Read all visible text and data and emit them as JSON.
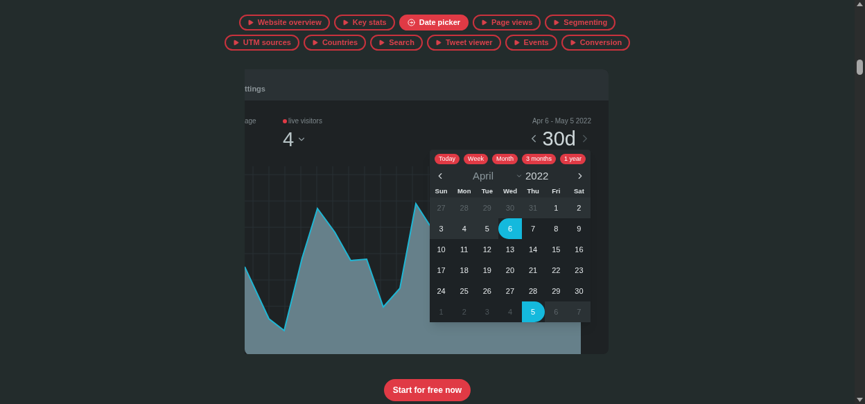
{
  "demo_tabs": [
    [
      {
        "label": "Website overview",
        "selected": false
      },
      {
        "label": "Key stats",
        "selected": false
      },
      {
        "label": "Date picker",
        "selected": true
      },
      {
        "label": "Page views",
        "selected": false
      },
      {
        "label": "Segmenting",
        "selected": false
      }
    ],
    [
      {
        "label": "UTM sources",
        "selected": false
      },
      {
        "label": "Countries",
        "selected": false
      },
      {
        "label": "Search",
        "selected": false
      },
      {
        "label": "Tweet viewer",
        "selected": false
      },
      {
        "label": "Events",
        "selected": false
      },
      {
        "label": "Conversion",
        "selected": false
      }
    ]
  ],
  "panel": {
    "header_tab": "ttings",
    "stat_left_label": "age",
    "live": {
      "label": "live visitors",
      "value": "4"
    },
    "range_label": "Apr 6 - May 5 2022",
    "period": "30d"
  },
  "date_picker": {
    "presets": [
      "Today",
      "Week",
      "Month",
      "3 months",
      "1 year"
    ],
    "month": "April",
    "year": "2022",
    "weekdays": [
      "Sun",
      "Mon",
      "Tue",
      "Wed",
      "Thu",
      "Fri",
      "Sat"
    ],
    "weeks": [
      [
        {
          "day": "27",
          "muted": true,
          "in_range": false,
          "selected": false
        },
        {
          "day": "28",
          "muted": true,
          "in_range": false,
          "selected": false
        },
        {
          "day": "29",
          "muted": true,
          "in_range": false,
          "selected": false
        },
        {
          "day": "30",
          "muted": true,
          "in_range": false,
          "selected": false
        },
        {
          "day": "31",
          "muted": true,
          "in_range": false,
          "selected": false
        },
        {
          "day": "1",
          "muted": false,
          "in_range": false,
          "selected": false
        },
        {
          "day": "2",
          "muted": false,
          "in_range": false,
          "selected": false
        }
      ],
      [
        {
          "day": "3",
          "muted": false,
          "in_range": false,
          "selected": false
        },
        {
          "day": "4",
          "muted": false,
          "in_range": false,
          "selected": false
        },
        {
          "day": "5",
          "muted": false,
          "in_range": false,
          "selected": false
        },
        {
          "day": "6",
          "muted": false,
          "in_range": true,
          "selected": true
        },
        {
          "day": "7",
          "muted": false,
          "in_range": true,
          "selected": false
        },
        {
          "day": "8",
          "muted": false,
          "in_range": true,
          "selected": false
        },
        {
          "day": "9",
          "muted": false,
          "in_range": true,
          "selected": false
        }
      ],
      [
        {
          "day": "10",
          "muted": false,
          "in_range": true,
          "selected": false
        },
        {
          "day": "11",
          "muted": false,
          "in_range": true,
          "selected": false
        },
        {
          "day": "12",
          "muted": false,
          "in_range": true,
          "selected": false
        },
        {
          "day": "13",
          "muted": false,
          "in_range": true,
          "selected": false
        },
        {
          "day": "14",
          "muted": false,
          "in_range": true,
          "selected": false
        },
        {
          "day": "15",
          "muted": false,
          "in_range": true,
          "selected": false
        },
        {
          "day": "16",
          "muted": false,
          "in_range": true,
          "selected": false
        }
      ],
      [
        {
          "day": "17",
          "muted": false,
          "in_range": true,
          "selected": false
        },
        {
          "day": "18",
          "muted": false,
          "in_range": true,
          "selected": false
        },
        {
          "day": "19",
          "muted": false,
          "in_range": true,
          "selected": false
        },
        {
          "day": "20",
          "muted": false,
          "in_range": true,
          "selected": false
        },
        {
          "day": "21",
          "muted": false,
          "in_range": true,
          "selected": false
        },
        {
          "day": "22",
          "muted": false,
          "in_range": true,
          "selected": false
        },
        {
          "day": "23",
          "muted": false,
          "in_range": true,
          "selected": false
        }
      ],
      [
        {
          "day": "24",
          "muted": false,
          "in_range": true,
          "selected": false
        },
        {
          "day": "25",
          "muted": false,
          "in_range": true,
          "selected": false
        },
        {
          "day": "26",
          "muted": false,
          "in_range": true,
          "selected": false
        },
        {
          "day": "27",
          "muted": false,
          "in_range": true,
          "selected": false
        },
        {
          "day": "28",
          "muted": false,
          "in_range": true,
          "selected": false
        },
        {
          "day": "29",
          "muted": false,
          "in_range": true,
          "selected": false
        },
        {
          "day": "30",
          "muted": false,
          "in_range": true,
          "selected": false
        }
      ],
      [
        {
          "day": "1",
          "muted": true,
          "in_range": true,
          "selected": false
        },
        {
          "day": "2",
          "muted": true,
          "in_range": true,
          "selected": false
        },
        {
          "day": "3",
          "muted": true,
          "in_range": true,
          "selected": false
        },
        {
          "day": "4",
          "muted": true,
          "in_range": true,
          "selected": false
        },
        {
          "day": "5",
          "muted": false,
          "in_range": true,
          "selected": true
        },
        {
          "day": "6",
          "muted": true,
          "in_range": false,
          "selected": false
        },
        {
          "day": "7",
          "muted": true,
          "in_range": false,
          "selected": false
        }
      ]
    ]
  },
  "cta": "Start for free now"
}
